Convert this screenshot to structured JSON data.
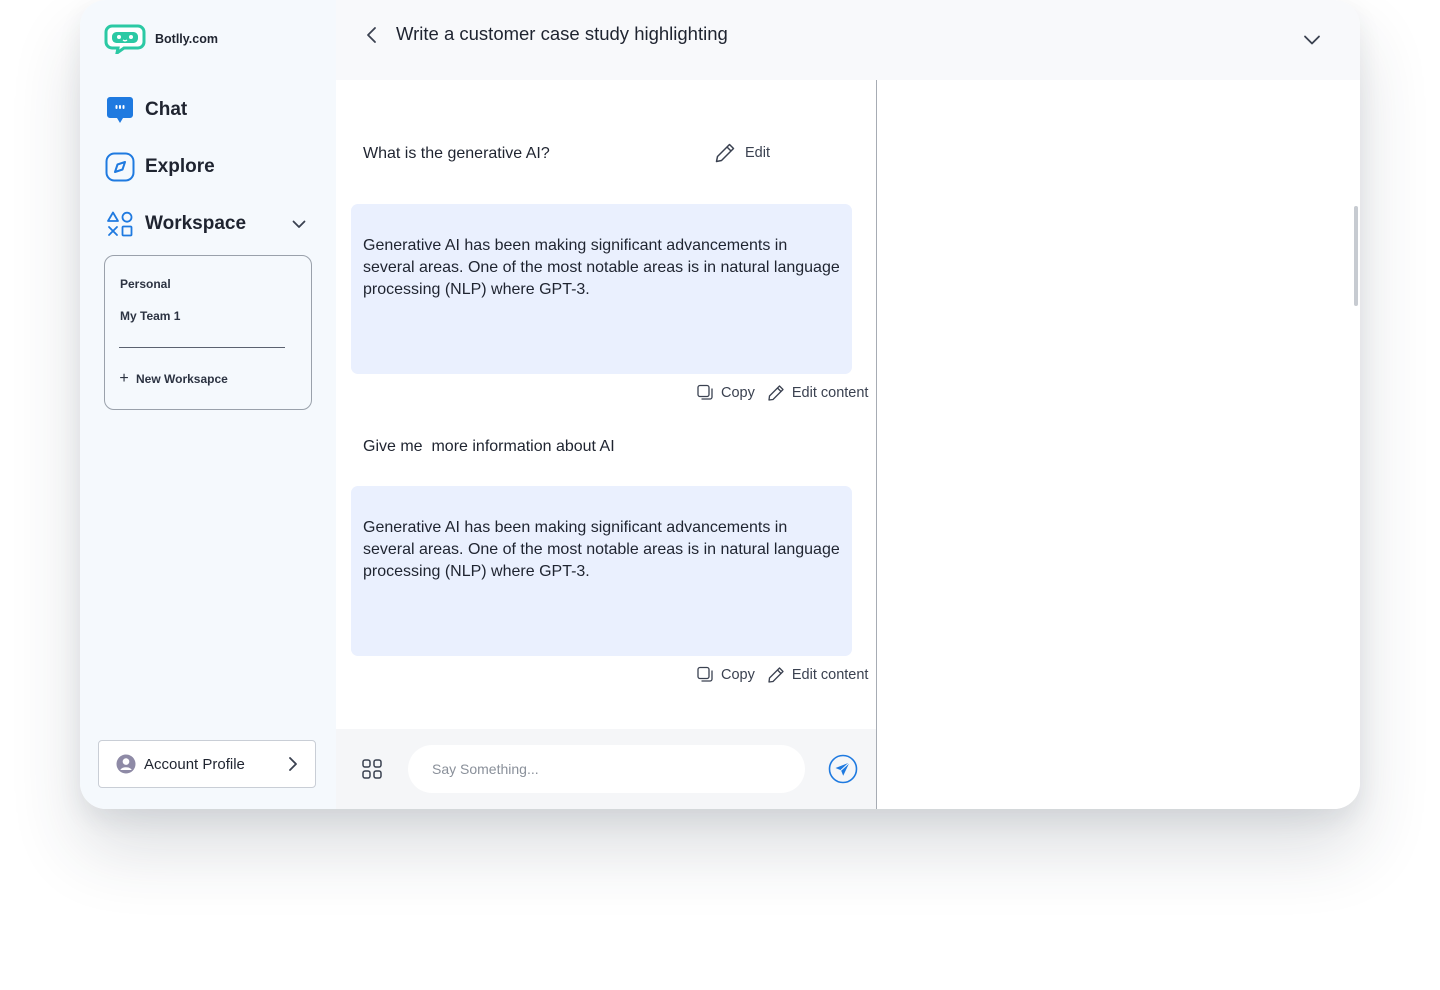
{
  "brand": {
    "name": "Botlly.com",
    "color": "#2bc9a4"
  },
  "sidebar": {
    "nav": [
      {
        "label": "Chat",
        "icon": "chat-bubble-icon"
      },
      {
        "label": "Explore",
        "icon": "compass-icon"
      },
      {
        "label": "Workspace",
        "icon": "shapes-icon"
      }
    ],
    "workspaces": [
      "Personal",
      "My Team 1"
    ],
    "new_workspace": "New Worksapce",
    "account": "Account Profile"
  },
  "header": {
    "title": "Write a customer case study highlighting"
  },
  "chat": {
    "messages": [
      {
        "prompt": "What is the generative AI?",
        "edit_label": "Edit",
        "response": "Generative AI has been making significant advancements in several areas. One of the most notable areas is in natural language processing (NLP) where GPT-3."
      },
      {
        "prompt": "Give me  more information about AI",
        "response": "Generative AI has been making significant advancements in several areas. One of the most notable areas is in natural language processing (NLP) where GPT-3."
      }
    ],
    "copy_label": "Copy",
    "edit_content_label": "Edit content"
  },
  "input": {
    "placeholder": "Say Something..."
  },
  "colors": {
    "accent": "#1f7ae0",
    "bubble": "#eaf0fe",
    "sidebar_bg": "#f5f9fd"
  }
}
